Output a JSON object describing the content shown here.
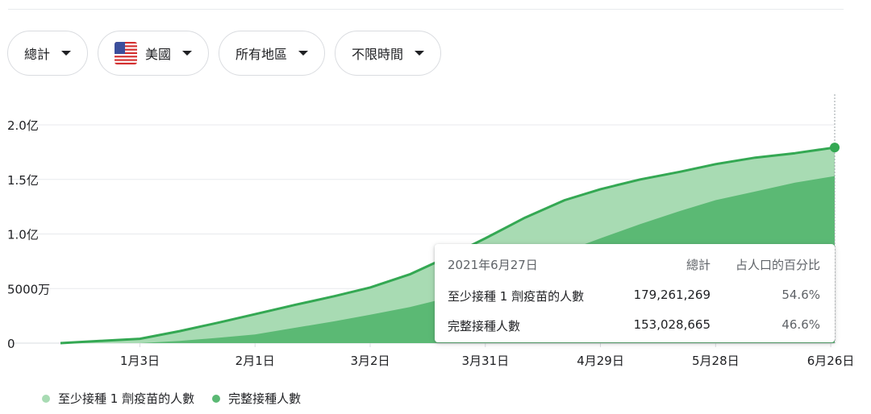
{
  "filters": [
    {
      "label": "總計",
      "icon": "caret-down-icon"
    },
    {
      "label": "美國",
      "icon": "us-flag-icon"
    },
    {
      "label": "所有地區",
      "icon": "caret-down-icon"
    },
    {
      "label": "不限時間",
      "icon": "caret-down-icon"
    }
  ],
  "colors": {
    "light": "#a8dbb3",
    "dark": "#5bb974",
    "line": "#34a853",
    "grid": "#e8eaed"
  },
  "tooltip": {
    "date": "2021年6月27日",
    "col_total": "總計",
    "col_pct": "占人口的百分比",
    "rows": [
      {
        "label": "至少接種 1 劑疫苗的人數",
        "total": "179,261,269",
        "pct": "54.6%"
      },
      {
        "label": "完整接種人數",
        "total": "153,028,665",
        "pct": "46.6%"
      }
    ]
  },
  "legend": [
    {
      "label": "至少接種 1 劑疫苗的人數",
      "color": "#a8dbb3"
    },
    {
      "label": "完整接種人數",
      "color": "#5bb974"
    }
  ],
  "chart_data": {
    "type": "area",
    "y_ticks": [
      {
        "value": 0,
        "label": "0"
      },
      {
        "value": 50000000,
        "label": "5000万"
      },
      {
        "value": 100000000,
        "label": "1.0亿"
      },
      {
        "value": 150000000,
        "label": "1.5亿"
      },
      {
        "value": 200000000,
        "label": "2.0亿"
      }
    ],
    "x_ticks": [
      {
        "date": "2021-01-03",
        "label": "1月3日"
      },
      {
        "date": "2021-02-01",
        "label": "2月1日"
      },
      {
        "date": "2021-03-02",
        "label": "3月2日"
      },
      {
        "date": "2021-03-31",
        "label": "3月31日"
      },
      {
        "date": "2021-04-29",
        "label": "4月29日"
      },
      {
        "date": "2021-05-28",
        "label": "5月28日"
      },
      {
        "date": "2021-06-26",
        "label": "6月26日"
      }
    ],
    "xlim": [
      "2020-12-14",
      "2021-06-27"
    ],
    "ylim": [
      0,
      200000000
    ],
    "grid": true,
    "legend_position": "bottom",
    "series": [
      {
        "name": "至少接種 1 劑疫苗的人數",
        "dates": [
          "2020-12-14",
          "2020-12-24",
          "2021-01-03",
          "2021-01-13",
          "2021-01-23",
          "2021-02-01",
          "2021-02-11",
          "2021-02-21",
          "2021-03-02",
          "2021-03-12",
          "2021-03-21",
          "2021-03-31",
          "2021-04-10",
          "2021-04-20",
          "2021-04-29",
          "2021-05-09",
          "2021-05-19",
          "2021-05-28",
          "2021-06-07",
          "2021-06-17",
          "2021-06-27"
        ],
        "values": [
          0,
          2000000,
          4000000,
          11000000,
          19000000,
          26500000,
          35000000,
          43000000,
          51000000,
          63000000,
          78000000,
          96000000,
          115000000,
          131000000,
          141000000,
          150000000,
          157000000,
          164000000,
          170000000,
          174000000,
          179261269
        ]
      },
      {
        "name": "完整接種人數",
        "dates": [
          "2020-12-14",
          "2020-12-24",
          "2021-01-03",
          "2021-01-13",
          "2021-01-23",
          "2021-02-01",
          "2021-02-11",
          "2021-02-21",
          "2021-03-02",
          "2021-03-12",
          "2021-03-21",
          "2021-03-31",
          "2021-04-10",
          "2021-04-20",
          "2021-04-29",
          "2021-05-09",
          "2021-05-19",
          "2021-05-28",
          "2021-06-07",
          "2021-06-17",
          "2021-06-27"
        ],
        "values": [
          0,
          0,
          0,
          2000000,
          5000000,
          8000000,
          14000000,
          20000000,
          26000000,
          33000000,
          41000000,
          52000000,
          68000000,
          84000000,
          96000000,
          109000000,
          121000000,
          131000000,
          139000000,
          147000000,
          153028665
        ]
      }
    ]
  }
}
